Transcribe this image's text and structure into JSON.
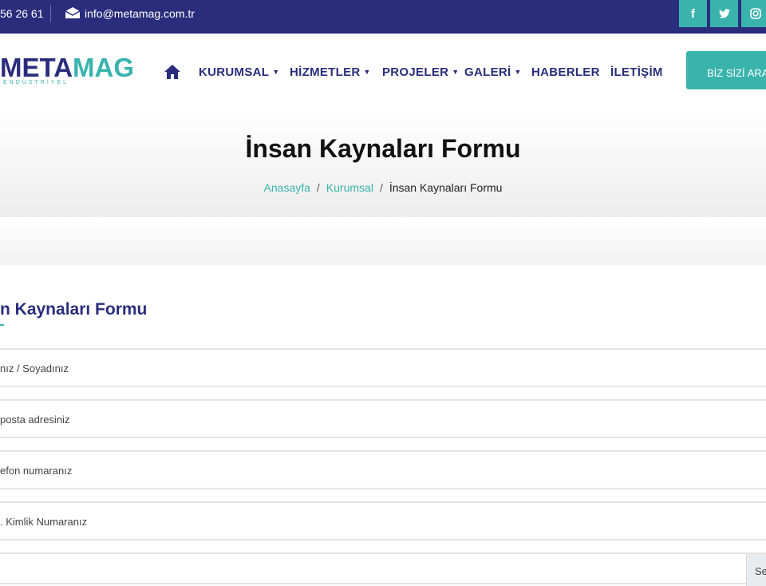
{
  "topbar": {
    "phone": "56 26 61",
    "email": "info@metamag.com.tr",
    "social": [
      "facebook-icon",
      "twitter-icon",
      "instagram-icon"
    ]
  },
  "header": {
    "logo_main": "META",
    "logo_accent": "MAG",
    "logo_sub": "ENDÜSTRİYEL",
    "nav": {
      "kurumsal": "KURUMSAL",
      "hizmetler": "HİZMETLER",
      "projeler": "PROJELER",
      "galeri": "GALERİ",
      "haberler": "HABERLER",
      "iletisim": "İLETİŞİM"
    },
    "cta_label": "BİZ SİZİ ARAYALIM"
  },
  "banner": {
    "title": "İnsan Kaynaları Formu",
    "breadcrumb": {
      "home": "Anasayfa",
      "parent": "Kurumsal",
      "current": "İnsan Kaynaları Formu",
      "separator": "/"
    }
  },
  "form": {
    "title": "n Kaynaları Formu",
    "fields": {
      "name": "nız / Soyadınız",
      "email": "posta adresiniz",
      "phone": "efon numaranız",
      "tc": ". Kimlik Numaranız"
    },
    "file_button": "Se"
  },
  "colors": {
    "navy": "#2a2d7c",
    "teal": "#3ab3ad"
  }
}
